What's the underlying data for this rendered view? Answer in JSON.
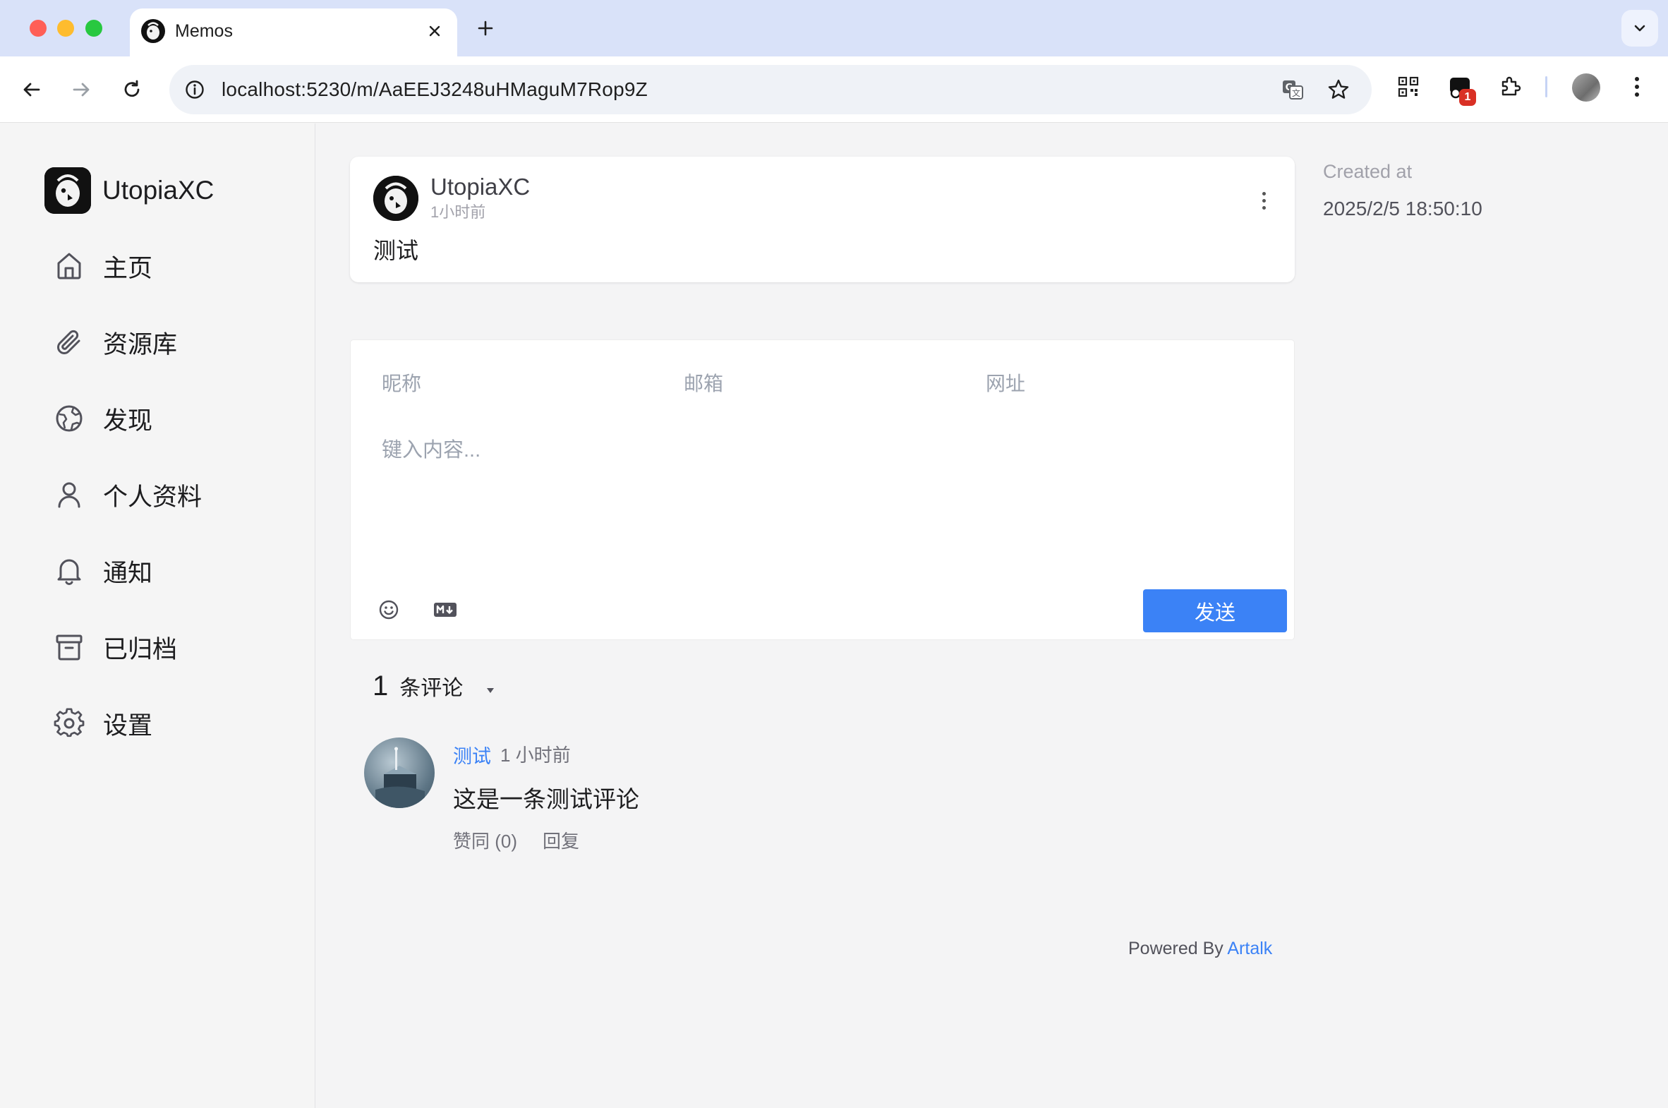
{
  "browser": {
    "tab_title": "Memos",
    "url": "localhost:5230/m/AaEEJ3248uHMaguM7Rop9Z",
    "extension_badge": "1",
    "icons": [
      "memos-favicon",
      "close-icon",
      "plus-icon",
      "chevron-down-icon",
      "back-arrow-icon",
      "forward-arrow-icon",
      "reload-icon",
      "info-icon",
      "translate-icon",
      "star-icon",
      "qr-code-icon",
      "extension-icon",
      "puzzle-icon",
      "kebab-menu-icon"
    ]
  },
  "sidebar": {
    "brand": "UtopiaXC",
    "items": [
      {
        "label": "主页",
        "icon": "home-icon"
      },
      {
        "label": "资源库",
        "icon": "paperclip-icon"
      },
      {
        "label": "发现",
        "icon": "globe-icon"
      },
      {
        "label": "个人资料",
        "icon": "user-icon"
      },
      {
        "label": "通知",
        "icon": "bell-icon"
      },
      {
        "label": "已归档",
        "icon": "archive-icon"
      },
      {
        "label": "设置",
        "icon": "gear-icon"
      }
    ]
  },
  "memo": {
    "author": "UtopiaXC",
    "time": "1小时前",
    "content": "测试"
  },
  "meta": {
    "label": "Created at",
    "value": "2025/2/5 18:50:10"
  },
  "comment_form": {
    "nick_placeholder": "昵称",
    "email_placeholder": "邮箱",
    "link_placeholder": "网址",
    "content_placeholder": "键入内容...",
    "send_label": "发送"
  },
  "comments_header": {
    "count": "1",
    "label": "条评论"
  },
  "comments": [
    {
      "nick": "测试",
      "time": "1 小时前",
      "content": "这是一条测试评论",
      "vote_label": "赞同 (0)",
      "reply_label": "回复"
    }
  ],
  "footer": {
    "powered_prefix": "Powered By",
    "powered_link": "Artalk"
  },
  "colors": {
    "accent": "#3b82f6",
    "tabbar": "#d9e2f9",
    "page_bg": "#f4f4f5"
  }
}
